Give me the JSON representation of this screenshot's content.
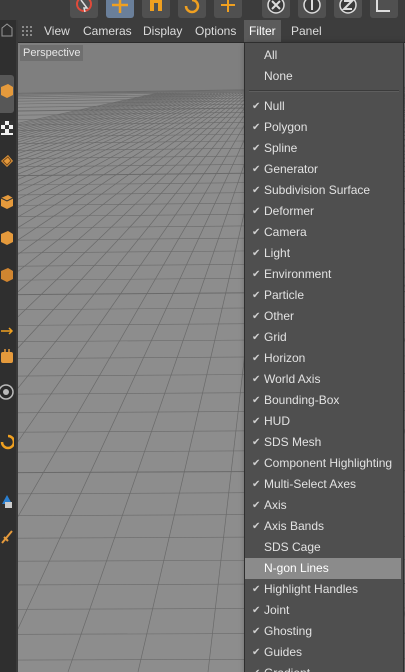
{
  "toolbar": {
    "buttons": [
      "live-selection-icon",
      "move-icon",
      "scale-icon",
      "rotate-icon",
      "last-tool-icon",
      "x-axis-lock-icon",
      "y-axis-lock-icon",
      "z-axis-lock-icon",
      "world-coordinates-icon"
    ]
  },
  "palette": {
    "icons": [
      "cube-icon",
      "checkerboard-icon",
      "texture-icon",
      "edge-icon",
      "polygon-icon",
      "object-icon",
      "axis-icon",
      "soft-selection-icon",
      "snap-icon",
      "workplane-icon",
      "lock-icon",
      "brush-icon"
    ]
  },
  "menubar": {
    "items": [
      "View",
      "Cameras",
      "Display",
      "Options",
      "Filter",
      "Panel"
    ],
    "active": "Filter"
  },
  "viewport": {
    "label": "Perspective"
  },
  "filter_menu": {
    "top_items": [
      "All",
      "None"
    ],
    "items": [
      {
        "label": "Null",
        "checked": true
      },
      {
        "label": "Polygon",
        "checked": true
      },
      {
        "label": "Spline",
        "checked": true
      },
      {
        "label": "Generator",
        "checked": true
      },
      {
        "label": "Subdivision Surface",
        "checked": true
      },
      {
        "label": "Deformer",
        "checked": true
      },
      {
        "label": "Camera",
        "checked": true
      },
      {
        "label": "Light",
        "checked": true
      },
      {
        "label": "Environment",
        "checked": true
      },
      {
        "label": "Particle",
        "checked": true
      },
      {
        "label": "Other",
        "checked": true
      },
      {
        "label": "Grid",
        "checked": true
      },
      {
        "label": "Horizon",
        "checked": true
      },
      {
        "label": "World Axis",
        "checked": true
      },
      {
        "label": "Bounding-Box",
        "checked": true
      },
      {
        "label": "HUD",
        "checked": true
      },
      {
        "label": "SDS Mesh",
        "checked": true
      },
      {
        "label": "Component Highlighting",
        "checked": true
      },
      {
        "label": "Multi-Select Axes",
        "checked": true
      },
      {
        "label": "Axis",
        "checked": true
      },
      {
        "label": "Axis Bands",
        "checked": true
      },
      {
        "label": "SDS Cage",
        "checked": false
      },
      {
        "label": "N-gon Lines",
        "checked": false,
        "highlighted": true
      },
      {
        "label": "Highlight Handles",
        "checked": true
      },
      {
        "label": "Joint",
        "checked": true
      },
      {
        "label": "Ghosting",
        "checked": true
      },
      {
        "label": "Guides",
        "checked": true
      },
      {
        "label": "Gradient",
        "checked": true
      }
    ],
    "check_glyph": "✔"
  }
}
